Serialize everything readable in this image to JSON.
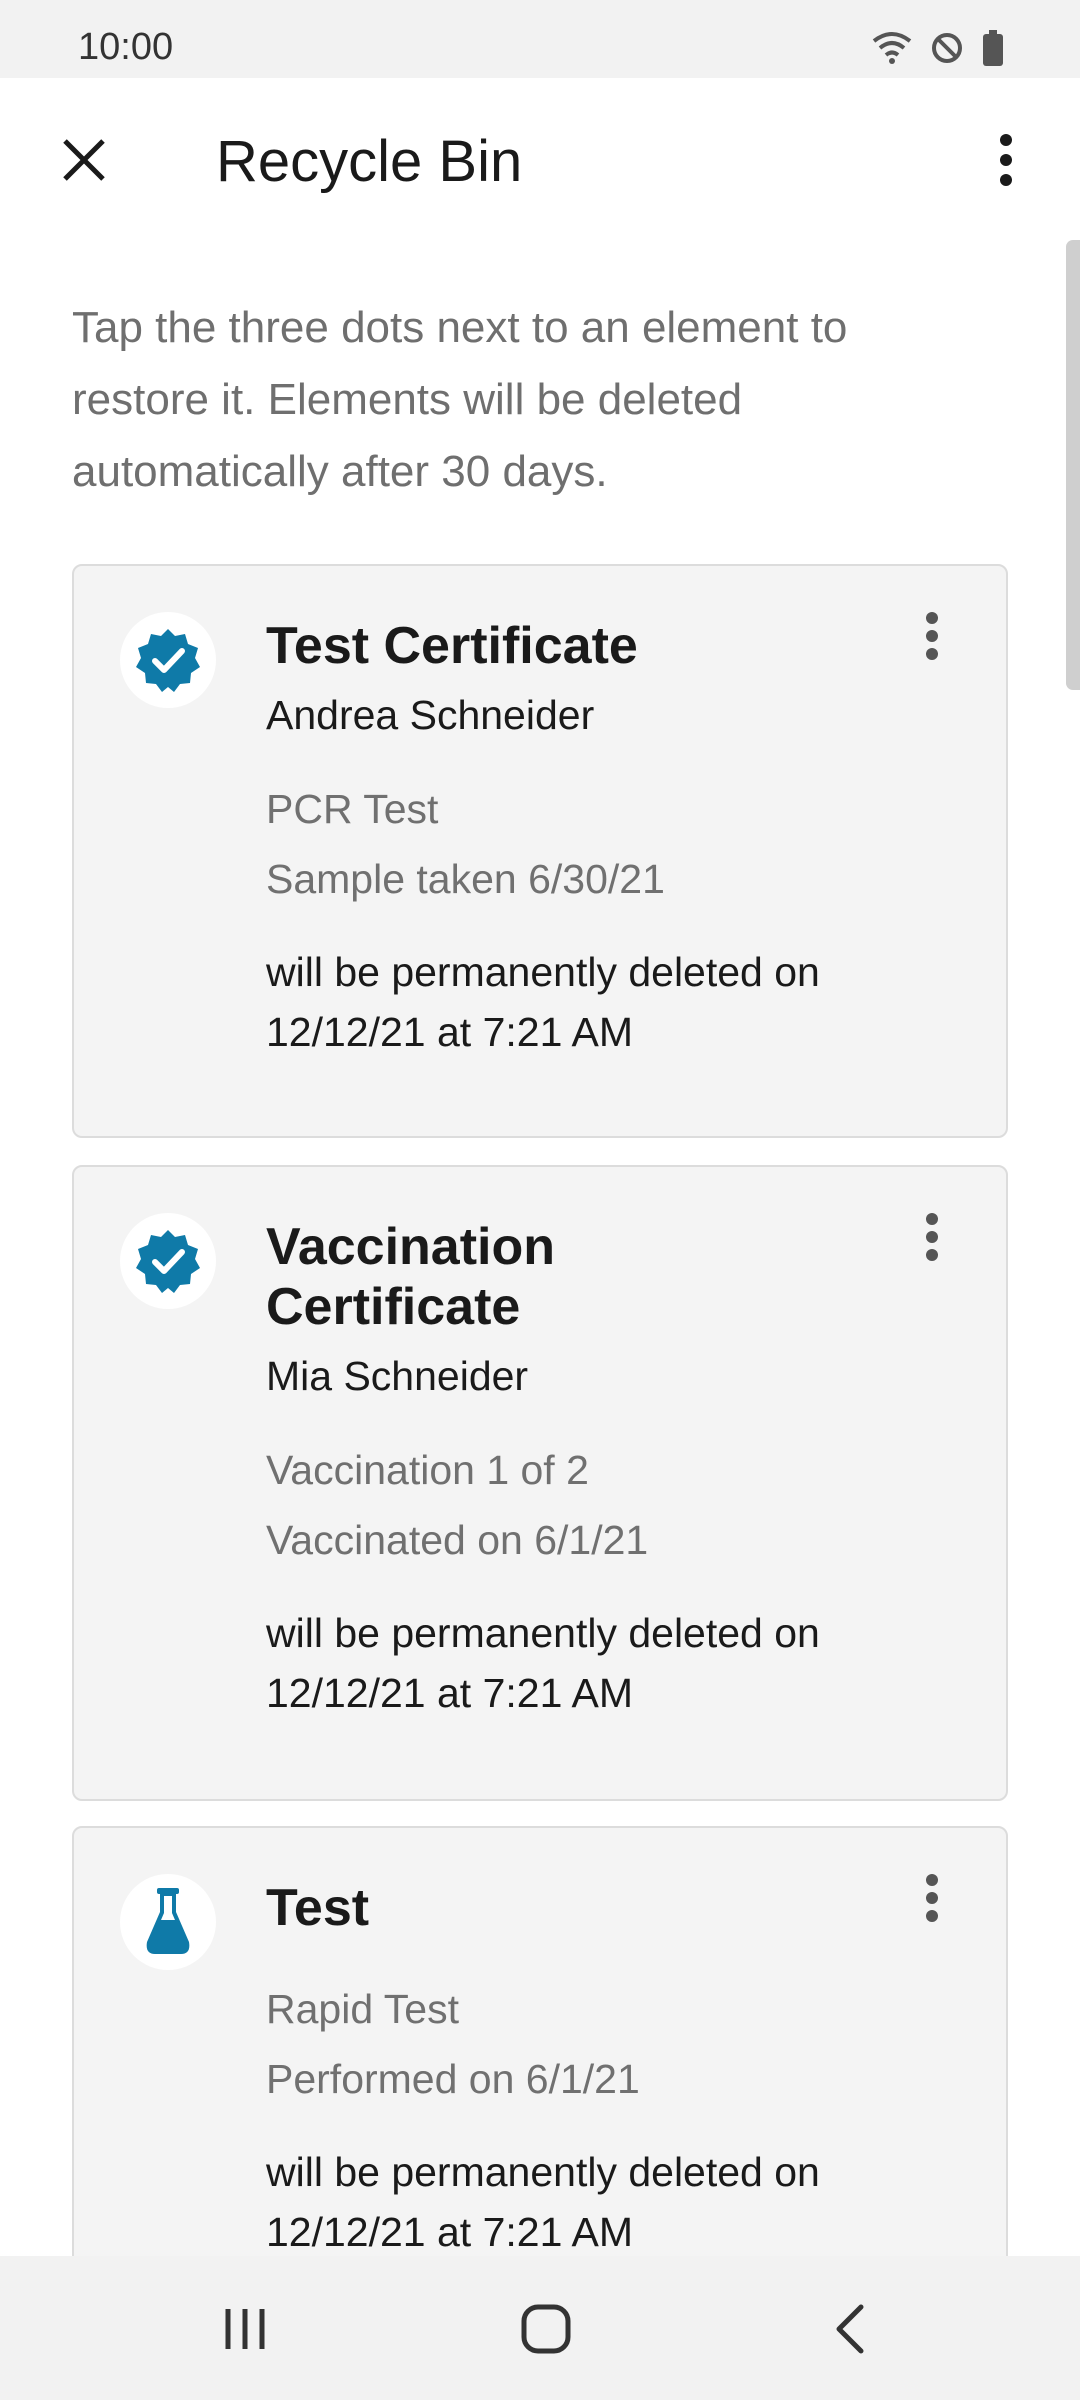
{
  "status_bar": {
    "time": "10:00",
    "icons": [
      "wifi-icon",
      "do-not-disturb-icon",
      "battery-icon"
    ]
  },
  "app_bar": {
    "title": "Recycle Bin",
    "close_icon": "close-icon",
    "more_icon": "more-vert-icon"
  },
  "intro_text": "Tap the three dots next to an element to restore it. Elements will be deleted automatically after 30 days.",
  "items": [
    {
      "icon": "verified-badge-icon",
      "title": "Test Certificate",
      "name": "Andrea Schneider",
      "detail_1": "PCR Test",
      "detail_2": "Sample taken 6/30/21",
      "deletion": "will be permanently deleted on 12/12/21 at 7:21 AM"
    },
    {
      "icon": "verified-badge-icon",
      "title": "Vaccination Certificate",
      "name": "Mia Schneider",
      "detail_1": "Vaccination 1 of 2",
      "detail_2": "Vaccinated on 6/1/21",
      "deletion": "will be permanently deleted on 12/12/21 at 7:21 AM"
    },
    {
      "icon": "flask-icon",
      "title": "Test",
      "detail_1": "Rapid Test",
      "detail_2": "Performed on 6/1/21",
      "deletion": "will be permanently deleted on 12/12/21 at 7:21 AM"
    }
  ],
  "nav_bar": {
    "recents": "recent-apps-icon",
    "home": "home-icon",
    "back": "back-icon"
  },
  "colors": {
    "accent": "#0f7aa8",
    "card_bg": "#f4f4f4",
    "muted_text": "#707070"
  }
}
